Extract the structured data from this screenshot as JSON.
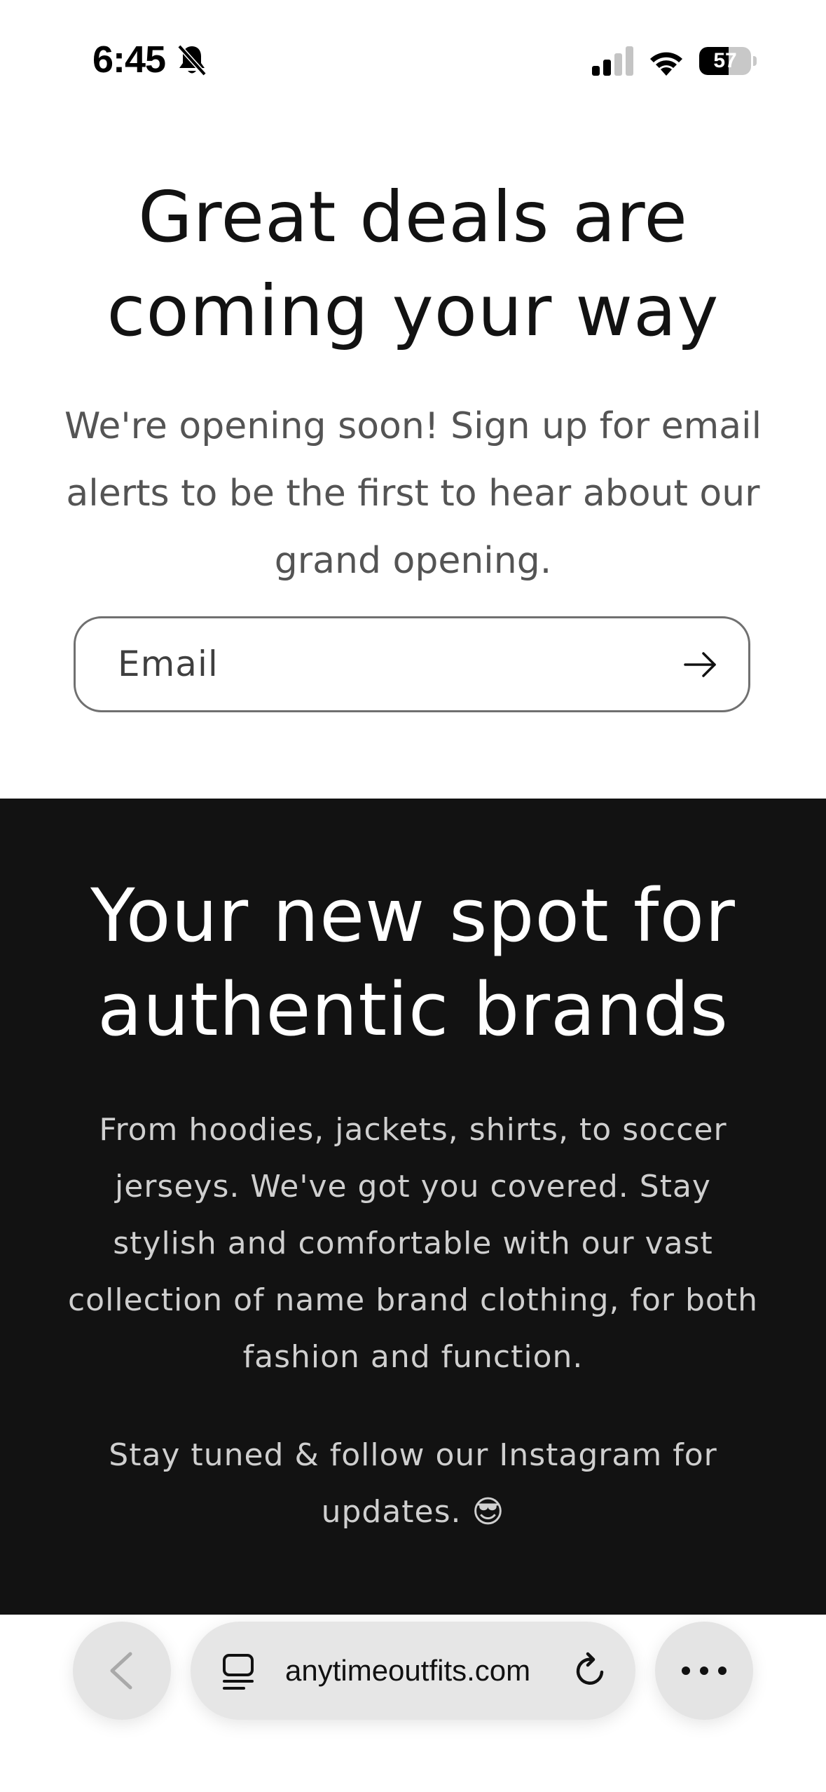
{
  "status_bar": {
    "time": "6:45",
    "battery_level": "57",
    "battery_fraction": 0.57,
    "signal_bars_active": 2,
    "signal_bars_total": 4,
    "icons": [
      "bell-off-icon",
      "signal-icon",
      "wifi-icon",
      "battery-icon"
    ]
  },
  "newsletter": {
    "heading": "Great deals are coming your way",
    "text": "We're opening soon! Sign up for email alerts to be the first to hear about our grand opening.",
    "email_placeholder": "Email",
    "submit_icon": "arrow-right-icon"
  },
  "promo": {
    "heading": "Your new spot for authentic brands",
    "paragraph": "From hoodies, jackets, shirts, to soccer jerseys. We've got you covered. Stay stylish and comfortable with our vast collection of name brand clothing, for both fashion and function.",
    "follow_text": "Stay tuned & follow our Instagram for updates.",
    "follow_emoji": "😎"
  },
  "browser": {
    "url": "anytimeoutfits.com",
    "icons": [
      "chevron-left-icon",
      "tabs-icon",
      "reload-icon",
      "more-icon"
    ]
  },
  "colors": {
    "page_background": "#ffffff",
    "heading_text": "#121212",
    "body_text": "#545454",
    "dark_section": "#121212",
    "dark_section_text": "#cfcfcf",
    "browser_control": "#e4e4e4"
  }
}
